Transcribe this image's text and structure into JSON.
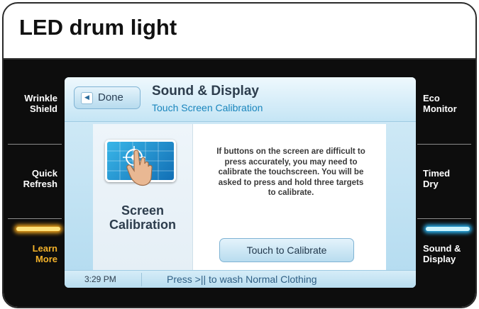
{
  "page": {
    "title": "LED drum light"
  },
  "left_keys": [
    {
      "label_line1": "Wrinkle",
      "label_line2": "Shield"
    },
    {
      "label_line1": "Quick",
      "label_line2": "Refresh"
    },
    {
      "label_line1": "Learn",
      "label_line2": "More"
    }
  ],
  "right_keys": [
    {
      "label_line1": "Eco",
      "label_line2": "Monitor"
    },
    {
      "label_line1": "Timed",
      "label_line2": "Dry"
    },
    {
      "label_line1": "Sound &",
      "label_line2": "Display"
    }
  ],
  "screen": {
    "header": {
      "done_label": "Done",
      "title": "Sound & Display",
      "subtitle": "Touch Screen Calibration"
    },
    "calibration": {
      "icon": "touch-target-icon",
      "label_line1": "Screen",
      "label_line2": "Calibration",
      "description_lines": [
        "If buttons on the screen are difficult to",
        "press accurately, you may need to",
        "calibrate the touchscreen. You will be",
        "asked to press and hold three targets",
        "to calibrate."
      ],
      "button_label": "Touch to Calibrate"
    },
    "status": {
      "time": "3:29 PM",
      "message": "Press >|| to wash Normal Clothing"
    }
  },
  "colors": {
    "learn_more_glow": "#f1a51b",
    "sound_display_glow": "#2ab3f0",
    "subtitle": "#1a86bd"
  }
}
